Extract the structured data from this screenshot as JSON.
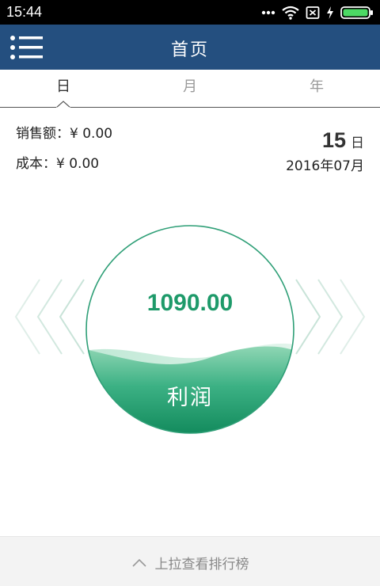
{
  "status_bar": {
    "time": "15:44"
  },
  "header": {
    "title": "首页"
  },
  "tabs": [
    {
      "label": "日",
      "active": true
    },
    {
      "label": "月",
      "active": false
    },
    {
      "label": "年",
      "active": false
    }
  ],
  "summary": {
    "sales_label": "销售额：",
    "sales_value": "¥ 0.00",
    "cost_label": "成本：",
    "cost_value": "¥ 0.00",
    "day": "15",
    "day_unit": "日",
    "month": "2016年07月"
  },
  "profit": {
    "value": "1090.00",
    "label": "利润"
  },
  "bottom": {
    "pull_text": "上拉查看排行榜"
  },
  "colors": {
    "header_bg": "#244f7f",
    "accent_green": "#1e9a6a",
    "chevron": "#d6ece4"
  },
  "icons": [
    "menu-icon",
    "wifi-icon",
    "sim-off-icon",
    "charging-icon",
    "battery-icon",
    "chevron-left-icon",
    "chevron-right-icon",
    "chevron-up-icon"
  ]
}
